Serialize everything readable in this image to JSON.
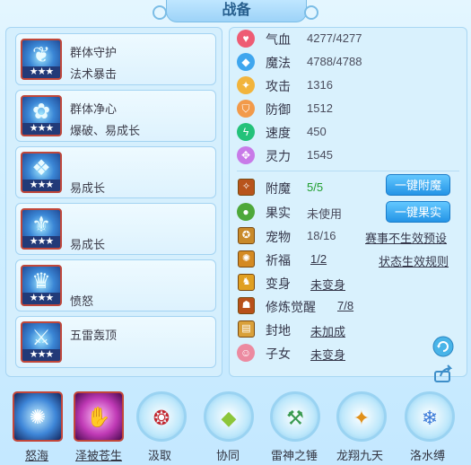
{
  "title": "战备",
  "equipment": [
    {
      "line1": "群体守护",
      "line2": "法术暴击",
      "stars": "★★★",
      "icon": "vine-crest-icon"
    },
    {
      "line1": "群体净心",
      "line2": "爆破、易成长",
      "stars": "★★★",
      "icon": "flower-crest-icon"
    },
    {
      "line1": "易成长",
      "line2": "",
      "stars": "★★★",
      "icon": "wing-crest-icon"
    },
    {
      "line1": "易成长",
      "line2": "",
      "stars": "★★★",
      "icon": "dragon-crest-icon"
    },
    {
      "line1": "愤怒",
      "line2": "",
      "stars": "★★★",
      "icon": "crown-crest-icon"
    },
    {
      "line1": "五雷轰顶",
      "line2": "",
      "stars": "★★★",
      "icon": "thunder-crest-icon"
    }
  ],
  "stats": [
    {
      "label": "气血",
      "value": "4277/4277",
      "icon": "heart-icon",
      "color": "#ee5c74"
    },
    {
      "label": "魔法",
      "value": "4788/4788",
      "icon": "diamond-icon",
      "color": "#3fa6ee"
    },
    {
      "label": "攻击",
      "value": "1316",
      "icon": "attack-icon",
      "color": "#f2b43c"
    },
    {
      "label": "防御",
      "value": "1512",
      "icon": "shield-icon",
      "color": "#f29a4a"
    },
    {
      "label": "速度",
      "value": "450",
      "icon": "lightning-icon",
      "color": "#24c27a"
    },
    {
      "label": "灵力",
      "value": "1545",
      "icon": "spirit-icon",
      "color": "#c87ae8"
    }
  ],
  "props": {
    "enchant": {
      "label": "附魔",
      "value": "5/5",
      "button": "一键附魔",
      "icon": "enchant-icon",
      "value_color": "#1f9e2e"
    },
    "fruit": {
      "label": "果实",
      "value": "未使用",
      "button": "一键果实",
      "icon": "fruit-icon"
    },
    "pet": {
      "label": "宠物",
      "value": "18/16",
      "link": "赛事不生效预设",
      "icon": "pet-icon"
    },
    "bless": {
      "label": "祈福",
      "value": "1/2",
      "link": "状态生效规则",
      "icon": "bless-icon"
    },
    "transform": {
      "label": "变身",
      "value": "未变身",
      "icon": "transform-icon"
    },
    "awaken": {
      "label": "修炼觉醒",
      "value": "7/8",
      "icon": "awaken-icon"
    },
    "territory": {
      "label": "封地",
      "value": "未加成",
      "icon": "territory-icon"
    },
    "child": {
      "label": "子女",
      "value": "未变身",
      "icon": "child-icon"
    }
  },
  "skills": [
    {
      "name": "怒海",
      "icon": "ocean-vortex-icon",
      "glyph": "✺",
      "style": "sq",
      "underline": true
    },
    {
      "name": "泽被苍生",
      "icon": "blessing-hand-icon",
      "glyph": "✋",
      "style": "sq2",
      "underline": true
    },
    {
      "name": "汲取",
      "icon": "absorb-orb-icon",
      "glyph": "❂",
      "style": "rd",
      "underline": false
    },
    {
      "name": "协同",
      "icon": "synergy-crystal-icon",
      "glyph": "◆",
      "style": "rd",
      "underline": false
    },
    {
      "name": "雷神之锤",
      "icon": "thunder-hammer-icon",
      "glyph": "⚒",
      "style": "rd",
      "underline": false
    },
    {
      "name": "龙翔九天",
      "icon": "dragon-soar-icon",
      "glyph": "✦",
      "style": "rd",
      "underline": false
    },
    {
      "name": "洛水缚",
      "icon": "water-bind-icon",
      "glyph": "❄",
      "style": "rd",
      "underline": false
    }
  ],
  "side_icons": [
    "refresh-icon",
    "share-icon"
  ]
}
